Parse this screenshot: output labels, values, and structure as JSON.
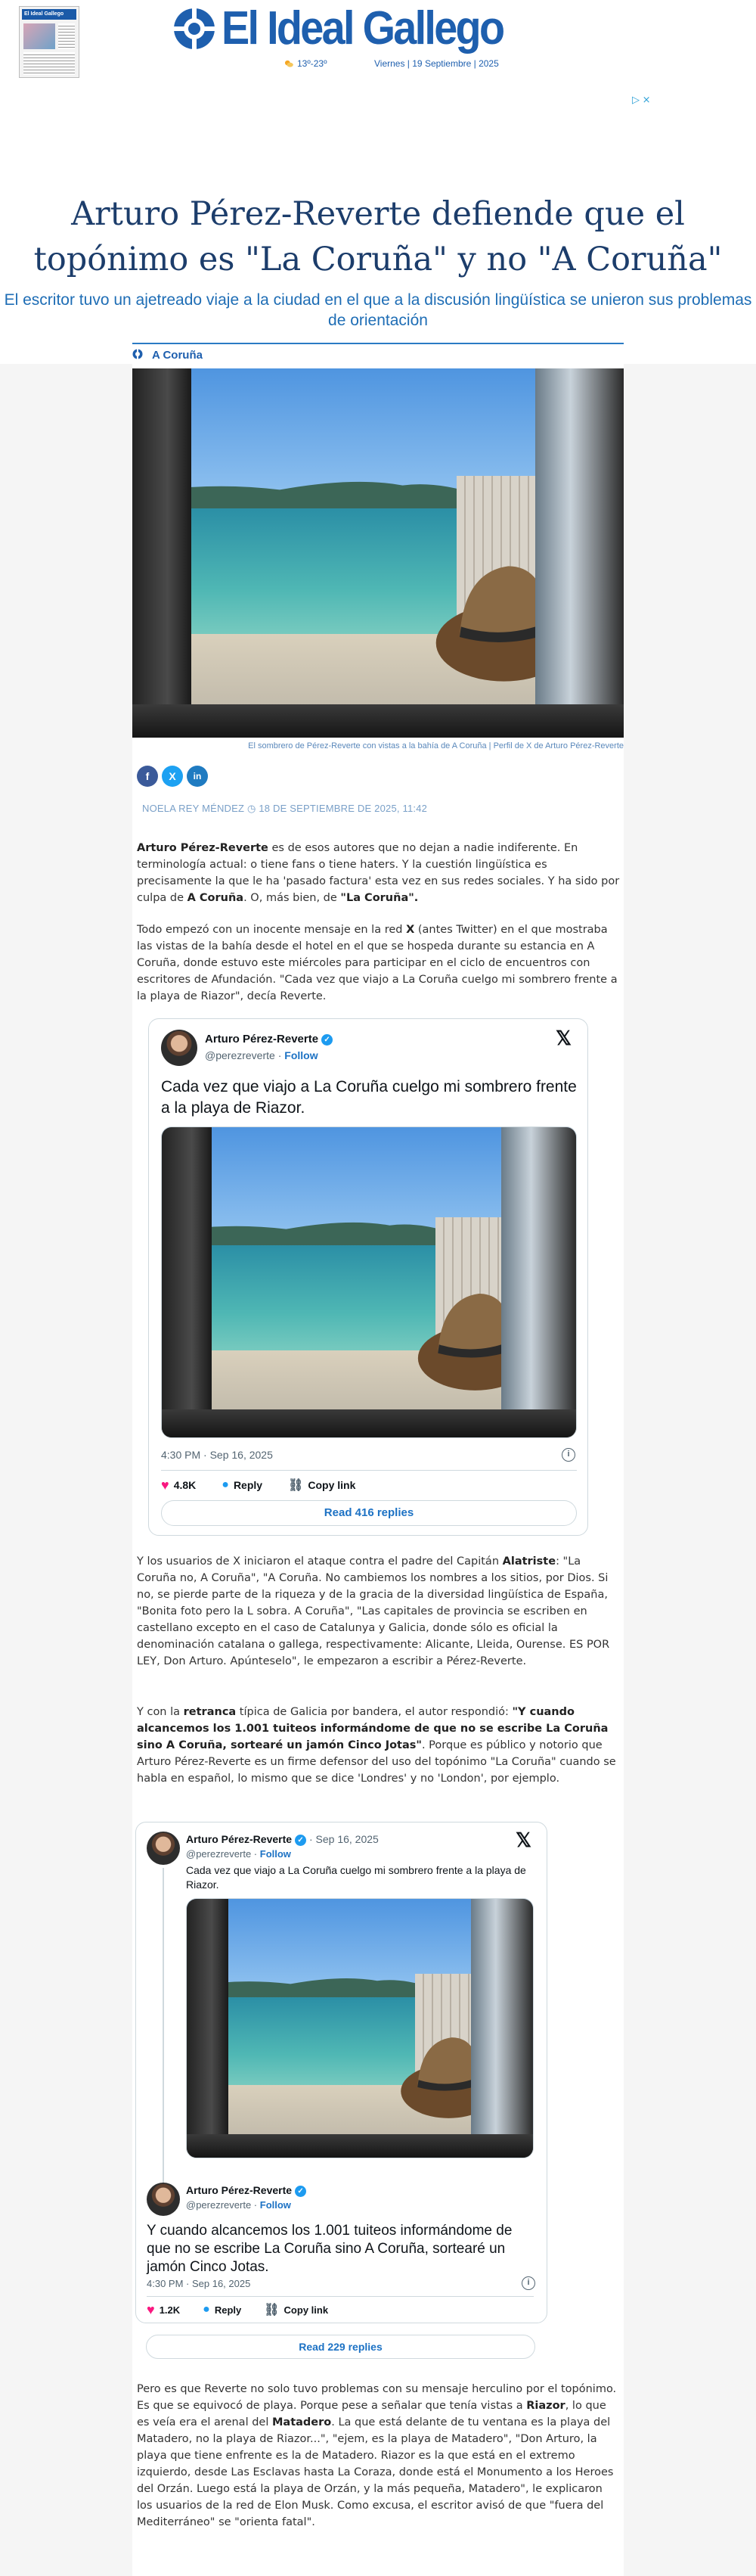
{
  "header": {
    "newspaper_thumb_title": "El Ideal Gallego",
    "logo_text": "El Ideal Gallego",
    "weather": "13º-23º",
    "date": "Viernes | 19 Septiembre | 2025"
  },
  "ad": {
    "marker": "▷ ⨯"
  },
  "article": {
    "headline": "Arturo Pérez-Reverte defiende que el topónimo es \"La Coruña\" y no \"A Coruña\"",
    "subheadline": "El escritor tuvo un ajetreado viaje a la ciudad en el que a la discusión lingüística se unieron sus problemas de orientación",
    "section": "A Coruña",
    "photo_caption": "El sombrero de Pérez-Reverte con vistas a la bahía de A Coruña | Perfil de X de Arturo Pérez-Reverte",
    "byline": "NOELA REY MÉNDEZ ◷ 18 DE SEPTIEMBRE DE 2025, 11:42",
    "share": {
      "facebook": "f",
      "x": "X",
      "linkedin": "in"
    }
  },
  "tweet1": {
    "name": "Arturo Pérez-Reverte",
    "handle": "@perezreverte",
    "follow": "Follow",
    "text": "Cada vez que viajo a La Coruña cuelgo mi sombrero frente a la playa de Riazor.",
    "time": "4:30 PM · Sep 16, 2025",
    "likes": "4.8K",
    "reply": "Reply",
    "copy": "Copy link",
    "replies_button": "Read 416 replies"
  },
  "tweet2": {
    "quoted_name": "Arturo Pérez-Reverte",
    "quoted_handle": "@perezreverte",
    "quoted_follow": "Follow",
    "quoted_date": "Sep 16, 2025",
    "quoted_text": "Cada vez que viajo a La Coruña cuelgo mi sombrero frente a la playa de Riazor.",
    "name": "Arturo Pérez-Reverte",
    "handle": "@perezreverte",
    "follow": "Follow",
    "text": "Y cuando alcancemos los 1.001 tuiteos informándome de que no se escribe La Coruña sino A Coruña, sortearé un jamón  Cinco Jotas.",
    "time": "4:30 PM · Sep 16, 2025",
    "likes": "1.2K",
    "reply": "Reply",
    "copy": "Copy link",
    "replies_button": "Read 229 replies"
  }
}
